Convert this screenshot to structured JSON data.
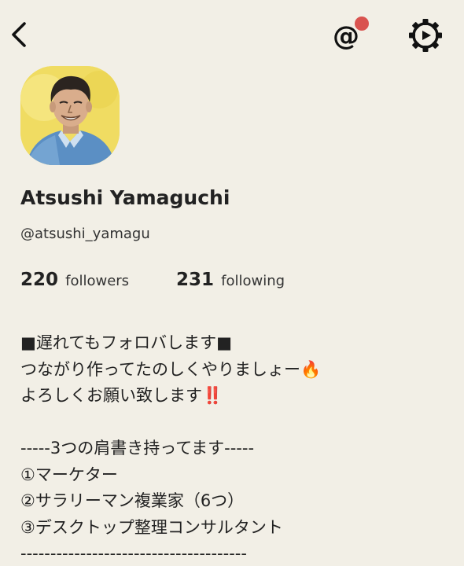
{
  "header": {
    "back_icon": "chevron-left-icon",
    "mention_icon": "at-sign-icon",
    "mention_glyph": "@",
    "notification_dot_color": "#d9534f",
    "settings_icon": "gear-icon"
  },
  "profile": {
    "avatar": "profile-photo-illustration",
    "name": "Atsushi Yamaguchi",
    "username": "@atsushi_yamagu",
    "followers_count": "220",
    "followers_label": "followers",
    "following_count": "231",
    "following_label": "following"
  },
  "bio": {
    "lines": [
      "■遅れてもフォロバします■",
      "つながり作ってたのしくやりましょー🔥",
      "よろしくお願い致します‼️",
      "",
      "-----3つの肩書き持ってます-----",
      "①マーケター",
      "②サラリーマン複業家（6つ）",
      "③デスクトップ整理コンサルタント",
      "--------------------------------------"
    ]
  },
  "colors": {
    "background": "#f2efe6",
    "text": "#222222",
    "avatar_background": "#f0dc62"
  }
}
